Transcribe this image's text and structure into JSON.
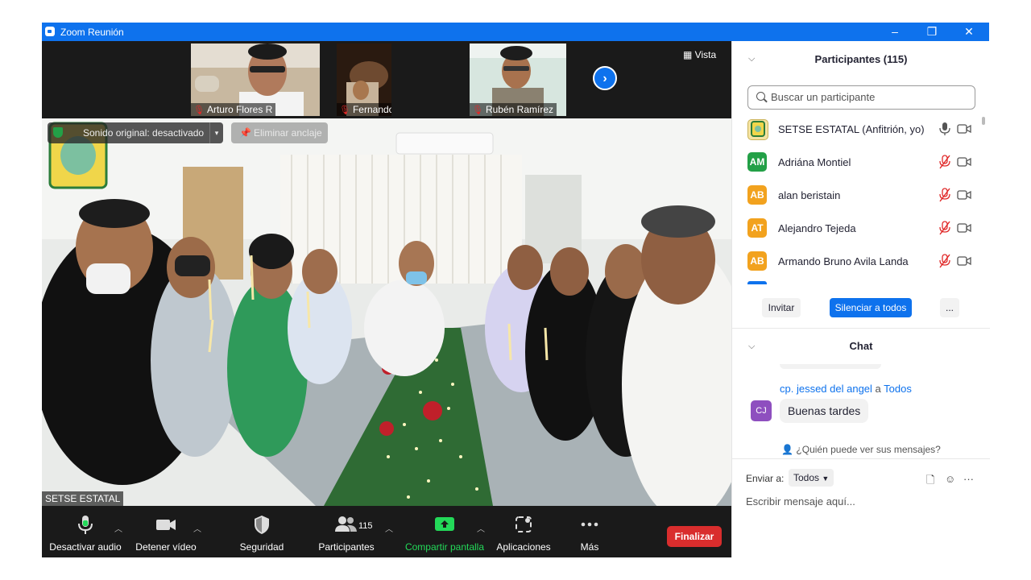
{
  "window": {
    "title": "Zoom Reunión",
    "minimize": "–",
    "restore": "❐",
    "close": "✕"
  },
  "thumbnails": [
    {
      "name": "Arturo Flores R"
    },
    {
      "name": "Fernando Benítez"
    },
    {
      "name": "Rubén Ramírez"
    }
  ],
  "view_label": "Vista",
  "main_video": {
    "speaker_name": "SETSE ESTATAL",
    "original_sound": "Sonido original: desactivado",
    "unpin_label": "Eliminar anclaje"
  },
  "toolbar": {
    "mute_label": "Desactivar audio",
    "video_label": "Detener vídeo",
    "security_label": "Seguridad",
    "participants_label": "Participantes",
    "participants_count": "115",
    "share_label": "Compartir pantalla",
    "apps_label": "Aplicaciones",
    "more_label": "Más",
    "end_label": "Finalizar"
  },
  "participants_panel": {
    "title": "Participantes (115)",
    "search_placeholder": "Buscar un participante",
    "items": [
      {
        "initials": "",
        "name": "SETSE ESTATAL (Anfitrión, yo)",
        "color": "#f4e3a1",
        "muted": false
      },
      {
        "initials": "AM",
        "name": "Adriána Montiel",
        "color": "#23a047",
        "muted": true
      },
      {
        "initials": "AB",
        "name": "alan beristain",
        "color": "#f2a21e",
        "muted": true
      },
      {
        "initials": "AT",
        "name": "Alejandro Tejeda",
        "color": "#f2a21e",
        "muted": true
      },
      {
        "initials": "AB",
        "name": "Armando Bruno Avila Landa",
        "color": "#f2a21e",
        "muted": true
      }
    ],
    "invite_label": "Invitar",
    "mute_all_label": "Silenciar a todos",
    "more_label": "..."
  },
  "chat": {
    "title": "Chat",
    "sender": "cp. jessed  del angel",
    "to_word": "a",
    "to_target": "Todos",
    "sender_initials": "CJ",
    "message": "Buenas tardes",
    "who_sees": "¿Quién puede ver sus mensajes?",
    "send_to_label": "Enviar a:",
    "send_to_value": "Todos",
    "input_placeholder": "Escribir mensaje aquí..."
  },
  "colors": {
    "zoom_blue": "#0e72ed",
    "end_red": "#d92d2d",
    "share_green": "#23d959",
    "muted_red": "#e02828"
  }
}
